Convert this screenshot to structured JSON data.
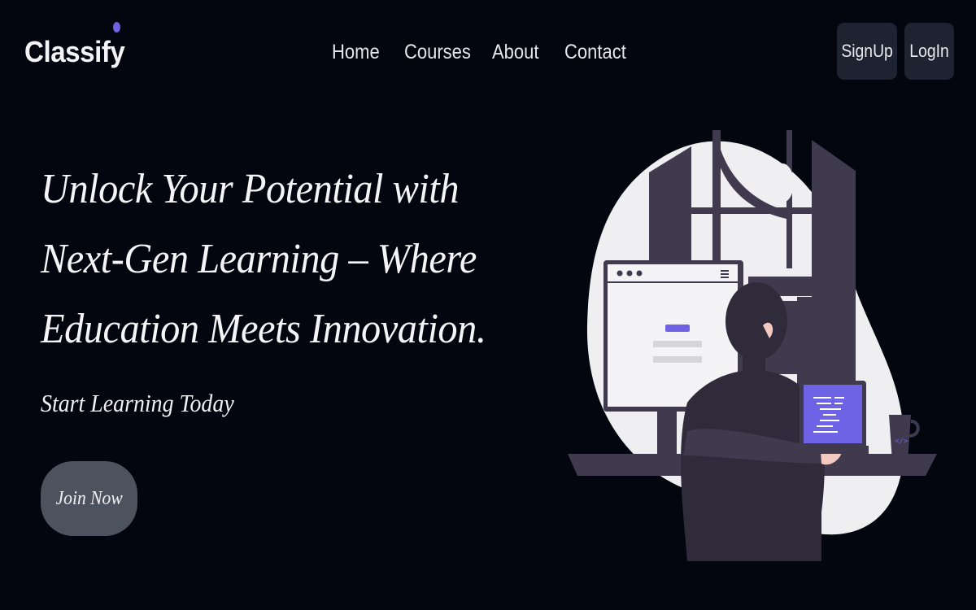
{
  "brand": {
    "name": "Classify",
    "accent_dot_color": "#6e62e5"
  },
  "nav": {
    "links": [
      {
        "label": "Home"
      },
      {
        "label": "Courses"
      },
      {
        "label": "About"
      },
      {
        "label": "Contact"
      }
    ],
    "signup_label": "SignUp",
    "login_label": "LogIn"
  },
  "hero": {
    "headline": "Unlock Your Potential with Next-Gen Learning – Where Education Meets Innovation.",
    "subheadline": "Start Learning Today",
    "cta_label": "Join Now"
  },
  "illustration": {
    "description_icon": "person-at-desk-with-computer-illustration",
    "laptop_screen_color": "#6e62e5",
    "monitor_button_color": "#6e62e5"
  },
  "theme": {
    "background": "#03060f",
    "button_bg": "#1d2330",
    "cta_bg": "#4d535e"
  }
}
